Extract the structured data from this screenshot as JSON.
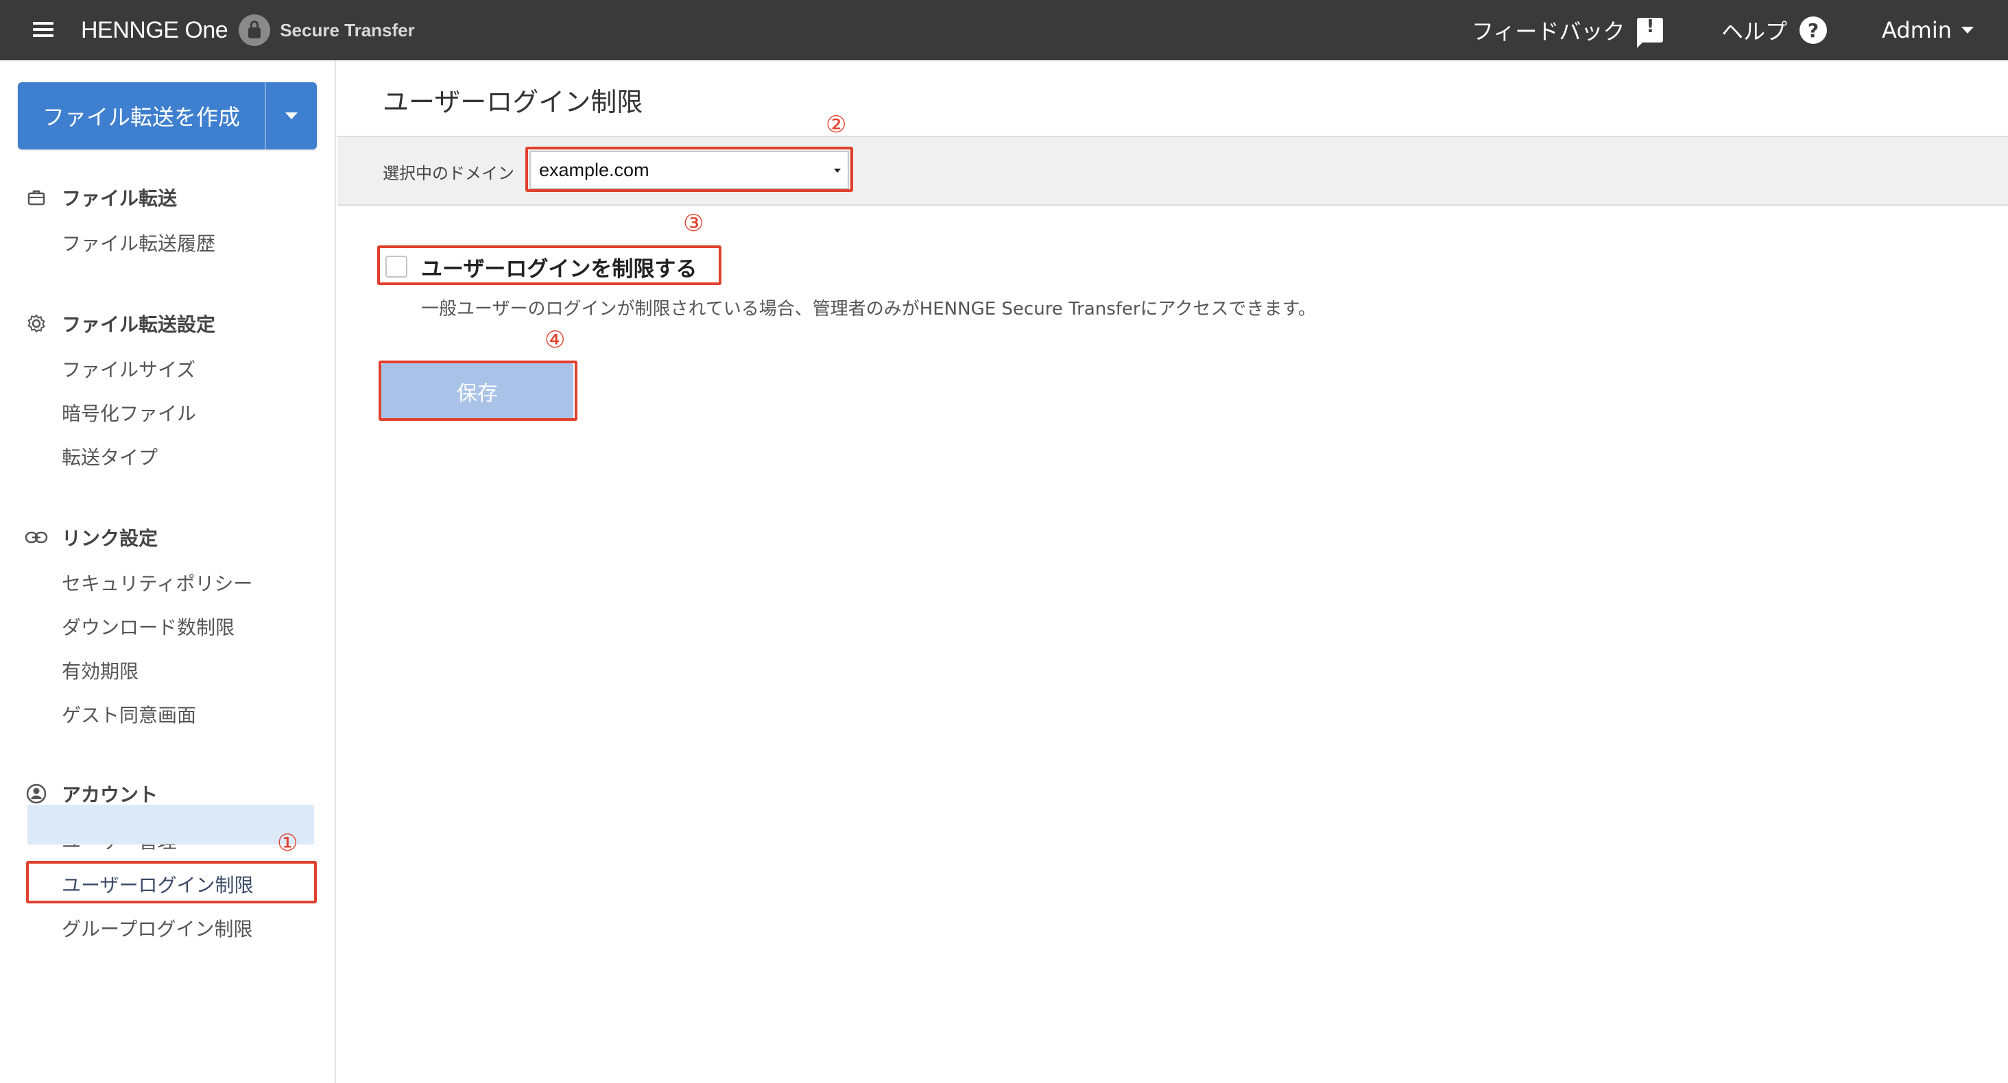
{
  "header": {
    "brand_name": "HENNGE One",
    "product_name": "Secure Transfer",
    "feedback_label": "フィードバック",
    "help_label": "ヘルプ",
    "help_icon_text": "?",
    "admin_label": "Admin"
  },
  "sidebar": {
    "create_button_label": "ファイル転送を作成",
    "sections": [
      {
        "title": "ファイル転送",
        "icon": "briefcase-icon",
        "items": [
          "ファイル転送履歴"
        ]
      },
      {
        "title": "ファイル転送設定",
        "icon": "gear-icon",
        "items": [
          "ファイルサイズ",
          "暗号化ファイル",
          "転送タイプ"
        ]
      },
      {
        "title": "リンク設定",
        "icon": "link-icon",
        "items": [
          "セキュリティポリシー",
          "ダウンロード数制限",
          "有効期限",
          "ゲスト同意画面"
        ]
      },
      {
        "title": "アカウント",
        "icon": "account-circle-icon",
        "items": [
          "ユーザー管理",
          "ユーザーログイン制限",
          "グループログイン制限"
        ]
      }
    ],
    "active_item": "ユーザーログイン制限"
  },
  "main": {
    "page_title": "ユーザーログイン制限",
    "domain_label": "選択中のドメイン",
    "domain_value": "example.com",
    "checkbox_label": "ユーザーログインを制限する",
    "checkbox_checked": false,
    "description": "一般ユーザーのログインが制限されている場合、管理者のみがHENNGE Secure Transferにアクセスできます。",
    "save_label": "保存"
  },
  "annotations": [
    "①",
    "②",
    "③",
    "④"
  ],
  "colors": {
    "header_bg": "#3a3a3a",
    "primary": "#3f7fcf",
    "save_disabled": "#a9c3e8",
    "annotation": "#e0412e",
    "active_nav_bg": "#dce9f8"
  }
}
